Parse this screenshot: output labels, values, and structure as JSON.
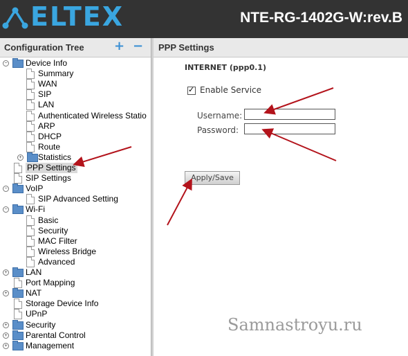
{
  "header": {
    "brand": "ELTEX",
    "model": "NTE-RG-1402G-W:rev.B",
    "brand_color": "#3aa6e0"
  },
  "sidebar": {
    "title": "Configuration Tree",
    "add_icon": "+",
    "remove_icon": "−",
    "nodes": [
      {
        "label": "Device Info",
        "type": "folder",
        "toggle": "−"
      },
      {
        "label": "Summary",
        "type": "page"
      },
      {
        "label": "WAN",
        "type": "page"
      },
      {
        "label": "SIP",
        "type": "page"
      },
      {
        "label": "LAN",
        "type": "page"
      },
      {
        "label": "Authenticated Wireless Statio",
        "type": "page"
      },
      {
        "label": "ARP",
        "type": "page"
      },
      {
        "label": "DHCP",
        "type": "page"
      },
      {
        "label": "Route",
        "type": "page"
      },
      {
        "label": "Statistics",
        "type": "folder",
        "toggle": "+"
      },
      {
        "label": "PPP Settings",
        "type": "page",
        "selected": true
      },
      {
        "label": "SIP Settings",
        "type": "page"
      },
      {
        "label": "VoIP",
        "type": "folder",
        "toggle": "−"
      },
      {
        "label": "SIP Advanced Setting",
        "type": "page"
      },
      {
        "label": "Wi-Fi",
        "type": "folder",
        "toggle": "−"
      },
      {
        "label": "Basic",
        "type": "page"
      },
      {
        "label": "Security",
        "type": "page"
      },
      {
        "label": "MAC Filter",
        "type": "page"
      },
      {
        "label": "Wireless Bridge",
        "type": "page"
      },
      {
        "label": "Advanced",
        "type": "page"
      },
      {
        "label": "LAN",
        "type": "folder",
        "toggle": "+"
      },
      {
        "label": "Port Mapping",
        "type": "page"
      },
      {
        "label": "NAT",
        "type": "folder",
        "toggle": "+"
      },
      {
        "label": "Storage Device Info",
        "type": "page"
      },
      {
        "label": "UPnP",
        "type": "page"
      },
      {
        "label": "Security",
        "type": "folder",
        "toggle": "+"
      },
      {
        "label": "Parental Control",
        "type": "folder",
        "toggle": "+"
      },
      {
        "label": "Management",
        "type": "folder",
        "toggle": "+"
      }
    ]
  },
  "main": {
    "title": "PPP Settings",
    "section": "INTERNET (ppp0.1)",
    "enable_service_label": "Enable Service",
    "enable_service_checked": true,
    "username_label": "Username:",
    "username_value": "",
    "password_label": "Password:",
    "password_value": "",
    "apply_label": "Apply/Save"
  },
  "watermark": "Samnastroyu.ru",
  "annotation_color": "#b3131b"
}
